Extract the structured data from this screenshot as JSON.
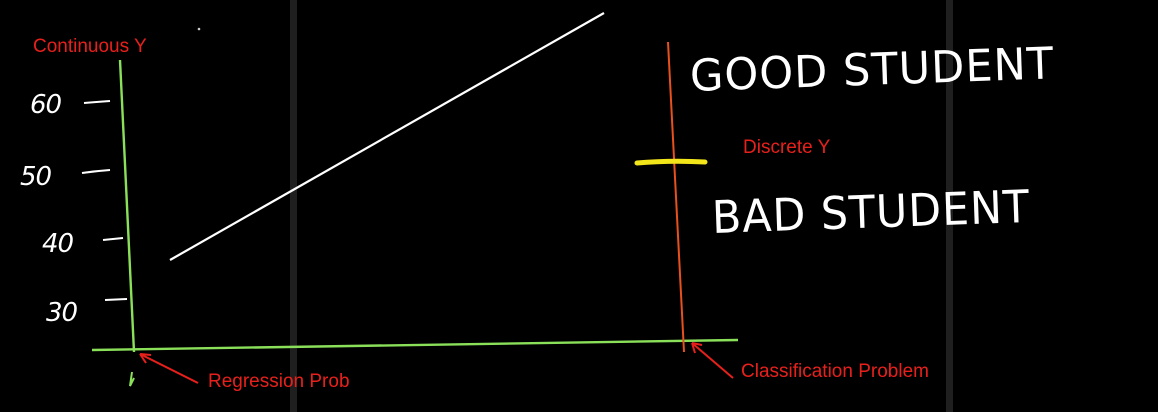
{
  "labels": {
    "continuous_y": "Continuous Y",
    "discrete_y": "Discrete Y",
    "regression": "Regression Prob",
    "classification": "Classification Problem"
  },
  "ticks": [
    "60",
    "50",
    "40",
    "30"
  ],
  "handwriting": {
    "good": "GOOD STUDENT",
    "bad": "BAD STUDENT"
  },
  "colors": {
    "background": "#000000",
    "axis_green": "#8be05a",
    "axis_orange": "#e8501e",
    "annotation_red": "#e8201c",
    "marker_yellow": "#f2e51a",
    "chalk_white": "#ffffff"
  }
}
